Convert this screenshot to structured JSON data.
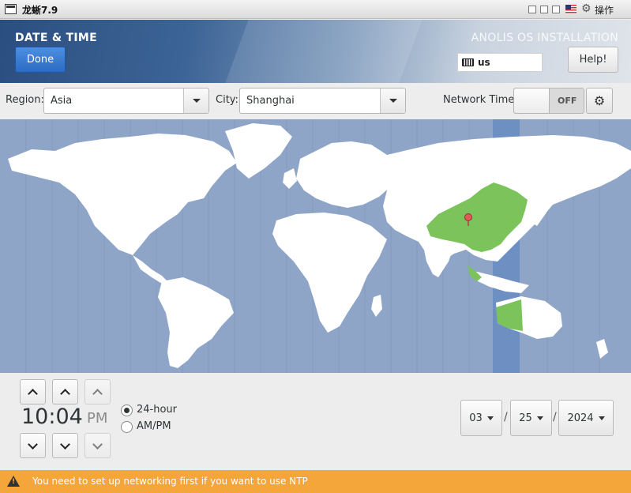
{
  "window": {
    "title": "龙蜥7.9",
    "action_label": "操作",
    "icons": [
      "app-icon",
      "minimize-icon",
      "maximize-icon",
      "close-icon",
      "us-flag-icon",
      "gear-icon"
    ]
  },
  "header": {
    "title": "DATE & TIME",
    "product": "ANOLIS OS INSTALLATION",
    "done_label": "Done",
    "help_label": "Help!",
    "keyboard_layout": "us"
  },
  "region_bar": {
    "region_label": "Region:",
    "region_value": "Asia",
    "city_label": "City:",
    "city_value": "Shanghai",
    "network_time_label": "Network Time",
    "network_time_state": "OFF"
  },
  "map": {
    "selected_timezone": "Asia/Shanghai",
    "colors": {
      "ocean": "#8fa5c8",
      "land": "#ffffff",
      "highlight": "#7bc35a",
      "selected_band": "#6d8fc2",
      "pin": "#e05a5a"
    }
  },
  "time": {
    "hours": "10",
    "separator": ":",
    "minutes": "04",
    "ampm": "PM",
    "format_24h_label": "24-hour",
    "format_ampm_label": "AM/PM",
    "selected_format": "24-hour"
  },
  "date": {
    "month": "03",
    "day": "25",
    "year": "2024",
    "separator": "/"
  },
  "warning": {
    "text": "You need to set up networking first if you want to use NTP"
  }
}
